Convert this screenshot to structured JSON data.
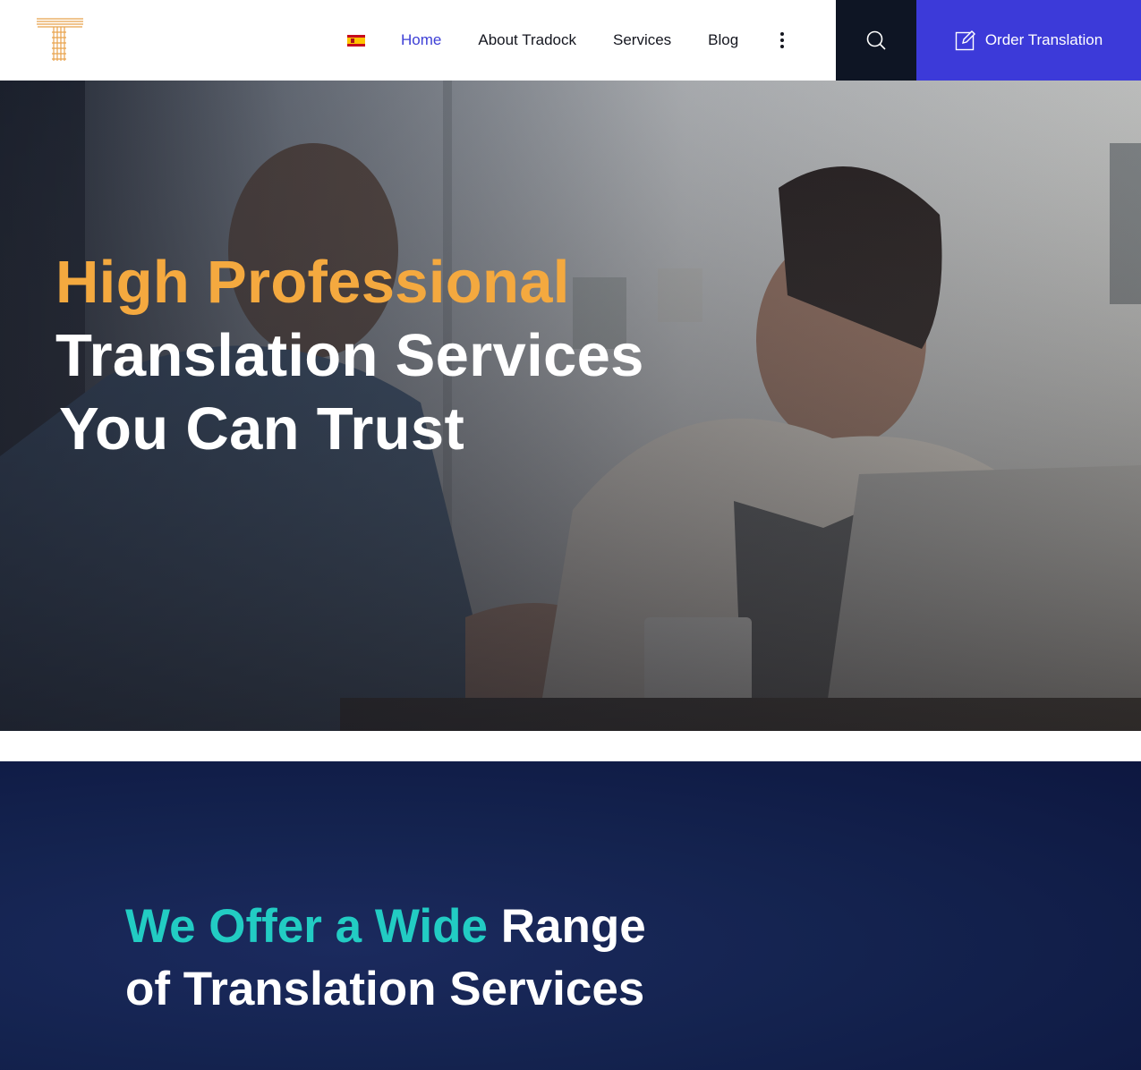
{
  "header": {
    "logo_icon": "tradock-t-logo-icon",
    "language_flag": "spain-flag-icon",
    "nav": [
      {
        "label": "Home",
        "active": true
      },
      {
        "label": "About Tradock",
        "active": false
      },
      {
        "label": "Services",
        "active": false
      },
      {
        "label": "Blog",
        "active": false
      }
    ],
    "more_icon": "vertical-dots-icon",
    "search_icon": "search-icon",
    "order_button": {
      "label": "Order Translation",
      "icon": "edit-icon"
    }
  },
  "hero": {
    "title_accent": "High Professional",
    "title_line2": "Translation Services",
    "title_line3": "You Can Trust"
  },
  "services": {
    "title_accent": "We Offer a Wide",
    "title_rest": "Range",
    "title_line2": "of Translation Services"
  },
  "colors": {
    "brand_blue": "#3c3ad9",
    "hero_accent": "#f4a93f",
    "services_accent": "#22ccc3",
    "dark_navy": "#0e1524"
  }
}
